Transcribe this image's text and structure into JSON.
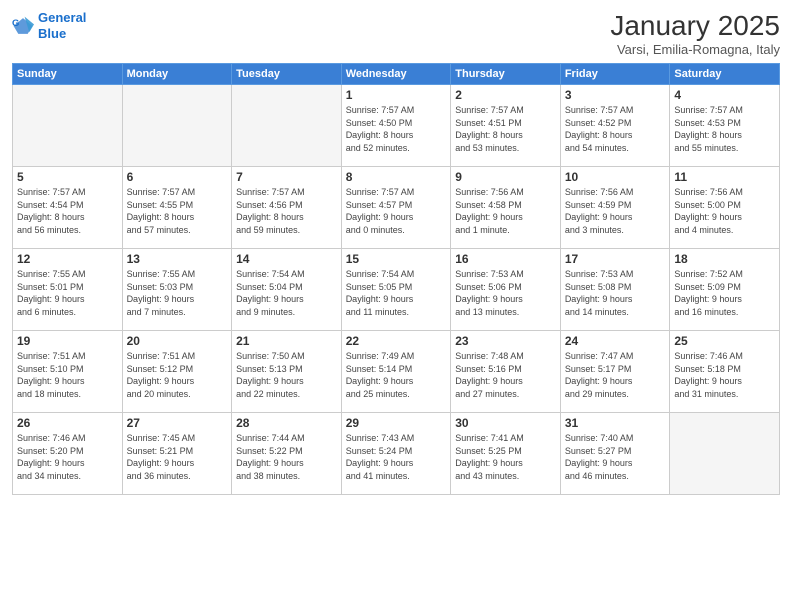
{
  "logo": {
    "line1": "General",
    "line2": "Blue"
  },
  "title": "January 2025",
  "location": "Varsi, Emilia-Romagna, Italy",
  "weekdays": [
    "Sunday",
    "Monday",
    "Tuesday",
    "Wednesday",
    "Thursday",
    "Friday",
    "Saturday"
  ],
  "weeks": [
    [
      {
        "day": "",
        "info": ""
      },
      {
        "day": "",
        "info": ""
      },
      {
        "day": "",
        "info": ""
      },
      {
        "day": "1",
        "info": "Sunrise: 7:57 AM\nSunset: 4:50 PM\nDaylight: 8 hours\nand 52 minutes."
      },
      {
        "day": "2",
        "info": "Sunrise: 7:57 AM\nSunset: 4:51 PM\nDaylight: 8 hours\nand 53 minutes."
      },
      {
        "day": "3",
        "info": "Sunrise: 7:57 AM\nSunset: 4:52 PM\nDaylight: 8 hours\nand 54 minutes."
      },
      {
        "day": "4",
        "info": "Sunrise: 7:57 AM\nSunset: 4:53 PM\nDaylight: 8 hours\nand 55 minutes."
      }
    ],
    [
      {
        "day": "5",
        "info": "Sunrise: 7:57 AM\nSunset: 4:54 PM\nDaylight: 8 hours\nand 56 minutes."
      },
      {
        "day": "6",
        "info": "Sunrise: 7:57 AM\nSunset: 4:55 PM\nDaylight: 8 hours\nand 57 minutes."
      },
      {
        "day": "7",
        "info": "Sunrise: 7:57 AM\nSunset: 4:56 PM\nDaylight: 8 hours\nand 59 minutes."
      },
      {
        "day": "8",
        "info": "Sunrise: 7:57 AM\nSunset: 4:57 PM\nDaylight: 9 hours\nand 0 minutes."
      },
      {
        "day": "9",
        "info": "Sunrise: 7:56 AM\nSunset: 4:58 PM\nDaylight: 9 hours\nand 1 minute."
      },
      {
        "day": "10",
        "info": "Sunrise: 7:56 AM\nSunset: 4:59 PM\nDaylight: 9 hours\nand 3 minutes."
      },
      {
        "day": "11",
        "info": "Sunrise: 7:56 AM\nSunset: 5:00 PM\nDaylight: 9 hours\nand 4 minutes."
      }
    ],
    [
      {
        "day": "12",
        "info": "Sunrise: 7:55 AM\nSunset: 5:01 PM\nDaylight: 9 hours\nand 6 minutes."
      },
      {
        "day": "13",
        "info": "Sunrise: 7:55 AM\nSunset: 5:03 PM\nDaylight: 9 hours\nand 7 minutes."
      },
      {
        "day": "14",
        "info": "Sunrise: 7:54 AM\nSunset: 5:04 PM\nDaylight: 9 hours\nand 9 minutes."
      },
      {
        "day": "15",
        "info": "Sunrise: 7:54 AM\nSunset: 5:05 PM\nDaylight: 9 hours\nand 11 minutes."
      },
      {
        "day": "16",
        "info": "Sunrise: 7:53 AM\nSunset: 5:06 PM\nDaylight: 9 hours\nand 13 minutes."
      },
      {
        "day": "17",
        "info": "Sunrise: 7:53 AM\nSunset: 5:08 PM\nDaylight: 9 hours\nand 14 minutes."
      },
      {
        "day": "18",
        "info": "Sunrise: 7:52 AM\nSunset: 5:09 PM\nDaylight: 9 hours\nand 16 minutes."
      }
    ],
    [
      {
        "day": "19",
        "info": "Sunrise: 7:51 AM\nSunset: 5:10 PM\nDaylight: 9 hours\nand 18 minutes."
      },
      {
        "day": "20",
        "info": "Sunrise: 7:51 AM\nSunset: 5:12 PM\nDaylight: 9 hours\nand 20 minutes."
      },
      {
        "day": "21",
        "info": "Sunrise: 7:50 AM\nSunset: 5:13 PM\nDaylight: 9 hours\nand 22 minutes."
      },
      {
        "day": "22",
        "info": "Sunrise: 7:49 AM\nSunset: 5:14 PM\nDaylight: 9 hours\nand 25 minutes."
      },
      {
        "day": "23",
        "info": "Sunrise: 7:48 AM\nSunset: 5:16 PM\nDaylight: 9 hours\nand 27 minutes."
      },
      {
        "day": "24",
        "info": "Sunrise: 7:47 AM\nSunset: 5:17 PM\nDaylight: 9 hours\nand 29 minutes."
      },
      {
        "day": "25",
        "info": "Sunrise: 7:46 AM\nSunset: 5:18 PM\nDaylight: 9 hours\nand 31 minutes."
      }
    ],
    [
      {
        "day": "26",
        "info": "Sunrise: 7:46 AM\nSunset: 5:20 PM\nDaylight: 9 hours\nand 34 minutes."
      },
      {
        "day": "27",
        "info": "Sunrise: 7:45 AM\nSunset: 5:21 PM\nDaylight: 9 hours\nand 36 minutes."
      },
      {
        "day": "28",
        "info": "Sunrise: 7:44 AM\nSunset: 5:22 PM\nDaylight: 9 hours\nand 38 minutes."
      },
      {
        "day": "29",
        "info": "Sunrise: 7:43 AM\nSunset: 5:24 PM\nDaylight: 9 hours\nand 41 minutes."
      },
      {
        "day": "30",
        "info": "Sunrise: 7:41 AM\nSunset: 5:25 PM\nDaylight: 9 hours\nand 43 minutes."
      },
      {
        "day": "31",
        "info": "Sunrise: 7:40 AM\nSunset: 5:27 PM\nDaylight: 9 hours\nand 46 minutes."
      },
      {
        "day": "",
        "info": ""
      }
    ]
  ]
}
